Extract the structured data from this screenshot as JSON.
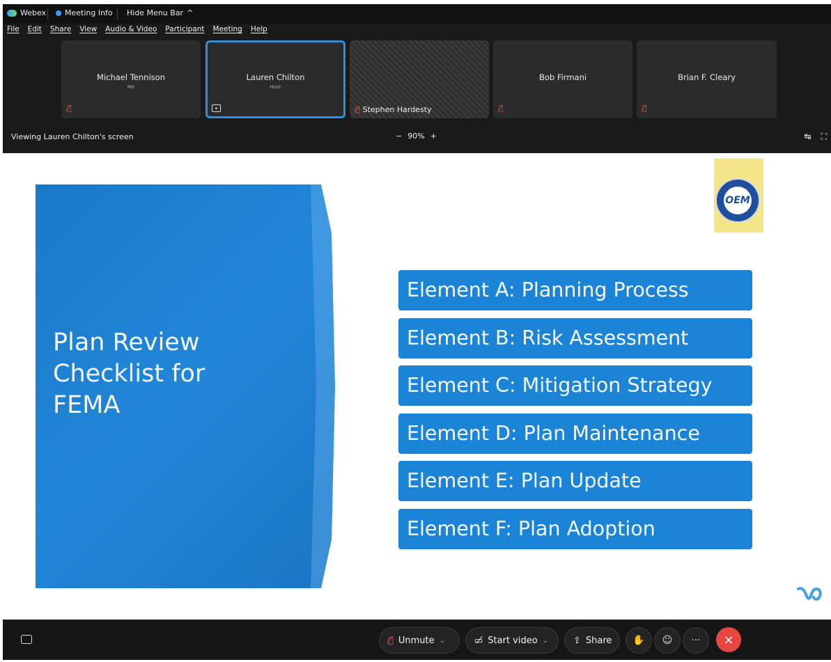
{
  "titlebar": {
    "app_name": "Webex",
    "meeting_info": "Meeting Info",
    "hide_menu": "Hide Menu Bar",
    "hide_menu_chevron": "^"
  },
  "menu": [
    "File",
    "Edit",
    "Share",
    "View",
    "Audio & Video",
    "Participant",
    "Meeting",
    "Help"
  ],
  "participants": [
    {
      "name": "Michael Tennison",
      "role": "Me"
    },
    {
      "name": "Lauren Chilton",
      "role": "Host"
    },
    {
      "name": "Stephen Hardesty",
      "role": ""
    },
    {
      "name": "Bob Firmani",
      "role": ""
    },
    {
      "name": "Brian F. Cleary",
      "role": ""
    }
  ],
  "viewbar": {
    "viewing_text": "Viewing Lauren Chilton's screen",
    "zoom_minus": "−",
    "zoom_level": "90%",
    "zoom_plus": "+"
  },
  "slide": {
    "title": "Plan Review Checklist for FEMA",
    "logo_text": "OEM",
    "elements": [
      "Element A: Planning Process",
      "Element B: Risk Assessment",
      "Element C: Mitigation Strategy",
      "Element D: Plan Maintenance",
      "Element E: Plan Update",
      "Element F: Plan Adoption"
    ]
  },
  "controls": {
    "unmute": "Unmute",
    "start_video": "Start video",
    "share": "Share",
    "more": "···"
  },
  "colors": {
    "accent": "#2f8fe0",
    "slide_blue": "#1b84d6",
    "end_red": "#e6463f",
    "mute_red": "#e0524e"
  },
  "icons": [
    "webex-logo-icon",
    "meeting-info-icon",
    "muted-mic-icon",
    "share-screen-icon",
    "chat-icon",
    "video-off-icon",
    "share-icon",
    "raise-hand-icon",
    "reactions-icon",
    "more-icon",
    "end-call-icon",
    "layout-icon",
    "fullscreen-icon"
  ]
}
